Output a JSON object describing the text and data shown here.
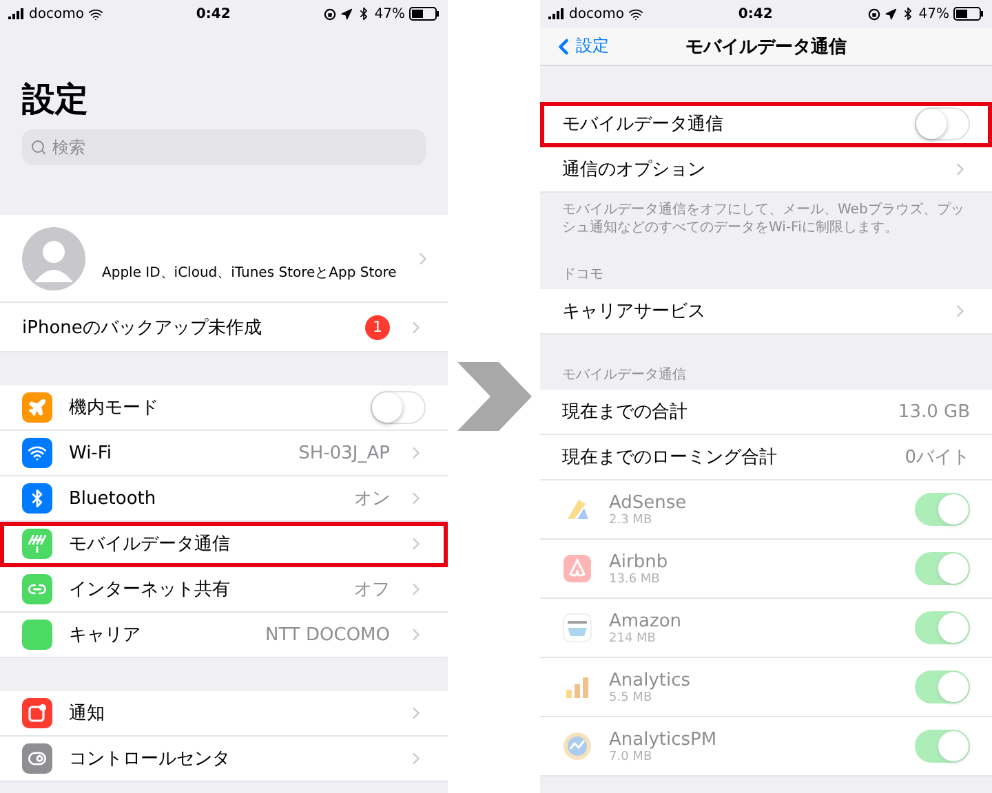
{
  "left": {
    "status_bar": {
      "carrier": "docomo",
      "time": "0:42",
      "battery": "47%"
    },
    "title": "設定",
    "search": {
      "placeholder": "検索"
    },
    "profile": {
      "subtitle": "Apple ID、iCloud、iTunes StoreとApp Store"
    },
    "backup": {
      "label": "iPhoneのバックアップ未作成",
      "badge": "1"
    },
    "groups": [
      [
        {
          "label": "機内モード",
          "kind": "toggle",
          "on": false,
          "highlighted": false,
          "color": "#ff9500"
        },
        {
          "label": "Wi-Fi",
          "kind": "link",
          "value": "SH-03J_AP",
          "highlighted": false,
          "color": "#007aff"
        },
        {
          "label": "Bluetooth",
          "kind": "link",
          "value": "オン",
          "highlighted": false,
          "color": "#007aff"
        },
        {
          "label": "モバイルデータ通信",
          "kind": "link",
          "highlighted": true,
          "color": "#4cd964"
        },
        {
          "label": "インターネット共有",
          "kind": "link",
          "value": "オフ",
          "highlighted": false,
          "color": "#4cd964"
        },
        {
          "label": "キャリア",
          "kind": "link",
          "value": "NTT DOCOMO",
          "highlighted": false,
          "color": "#4cd964"
        }
      ],
      [
        {
          "label": "通知",
          "kind": "link",
          "highlighted": false,
          "color": "#ff3b30"
        },
        {
          "label": "コントロールセンタ",
          "kind": "link",
          "highlighted": false,
          "color": "#8e8e93"
        }
      ]
    ]
  },
  "right": {
    "status_bar": {
      "carrier": "docomo",
      "time": "0:42",
      "battery": "47%"
    },
    "nav": {
      "back": "設定",
      "title": "モバイルデータ通信"
    },
    "mobile_data": {
      "label": "モバイルデータ通信",
      "on": false,
      "highlighted": true
    },
    "options": {
      "label": "通信のオプション"
    },
    "footer": "モバイルデータ通信をオフにして、メール、Webブラウズ、プッシュ通知などのすべてのデータをWi-Fiに制限します。",
    "carrier_header": "ドコモ",
    "carrier_services": "キャリアサービス",
    "usage_header": "モバイルデータ通信",
    "usage": [
      {
        "label": "現在までの合計",
        "value": "13.0 GB"
      },
      {
        "label": "現在までのローミング合計",
        "value": "0バイト"
      }
    ],
    "apps": [
      {
        "name": "AdSense",
        "size": "2.3 MB",
        "on": true,
        "disabled": true
      },
      {
        "name": "Airbnb",
        "size": "13.6 MB",
        "on": true,
        "disabled": true
      },
      {
        "name": "Amazon",
        "size": "214 MB",
        "on": true,
        "disabled": true
      },
      {
        "name": "Analytics",
        "size": "5.5 MB",
        "on": true,
        "disabled": true
      },
      {
        "name": "AnalyticsPM",
        "size": "7.0 MB",
        "on": true,
        "disabled": true
      }
    ]
  }
}
